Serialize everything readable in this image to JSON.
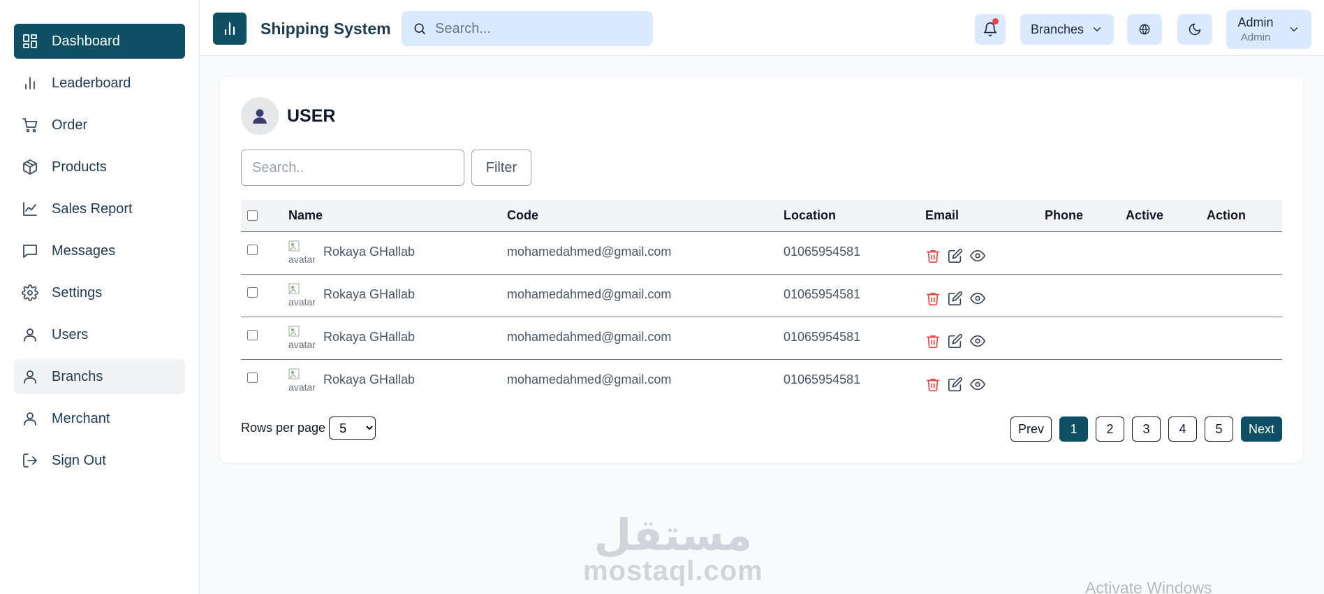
{
  "sidebar": {
    "items": [
      {
        "label": "Dashboard",
        "icon": "dashboard-icon"
      },
      {
        "label": "Leaderboard",
        "icon": "bar-chart-icon"
      },
      {
        "label": "Order",
        "icon": "cart-icon"
      },
      {
        "label": "Products",
        "icon": "package-icon"
      },
      {
        "label": "Sales Report",
        "icon": "line-chart-icon"
      },
      {
        "label": "Messages",
        "icon": "message-icon"
      },
      {
        "label": "Settings",
        "icon": "gear-icon"
      },
      {
        "label": "Users",
        "icon": "user-icon"
      },
      {
        "label": "Branchs",
        "icon": "user-icon"
      },
      {
        "label": "Merchant",
        "icon": "user-icon"
      },
      {
        "label": "Sign Out",
        "icon": "sign-out-icon"
      }
    ],
    "active_index": 0,
    "hover_index": 8
  },
  "header": {
    "title": "Shipping System",
    "search_placeholder": "Search...",
    "branches_label": "Branches",
    "admin_name": "Admin",
    "admin_role": "Admin"
  },
  "page": {
    "title": "USER",
    "search_placeholder": "Search..",
    "filter_label": "Filter"
  },
  "table": {
    "columns": [
      "Name",
      "Code",
      "Location",
      "Email",
      "Phone",
      "Active",
      "Action"
    ],
    "rows": [
      {
        "avatar_alt": "avatar",
        "name": "Rokaya GHallab",
        "code": "mohamedahmed@gmail.com",
        "location": "01065954581"
      },
      {
        "avatar_alt": "avatar",
        "name": "Rokaya GHallab",
        "code": "mohamedahmed@gmail.com",
        "location": "01065954581"
      },
      {
        "avatar_alt": "avatar",
        "name": "Rokaya GHallab",
        "code": "mohamedahmed@gmail.com",
        "location": "01065954581"
      },
      {
        "avatar_alt": "avatar",
        "name": "Rokaya GHallab",
        "code": "mohamedahmed@gmail.com",
        "location": "01065954581"
      }
    ]
  },
  "pagination": {
    "rows_per_page_label": "Rows per page",
    "rows_per_page_value": "5",
    "prev_label": "Prev",
    "next_label": "Next",
    "pages": [
      "1",
      "2",
      "3",
      "4",
      "5"
    ],
    "current_page": "1"
  },
  "watermark": {
    "arabic": "مستقل",
    "latin": "mostaql.com"
  },
  "os_overlay": {
    "text": "Activate Windows"
  },
  "colors": {
    "primary": "#0e4f63",
    "search_bg": "#dbeafe",
    "danger": "#ef4444"
  }
}
